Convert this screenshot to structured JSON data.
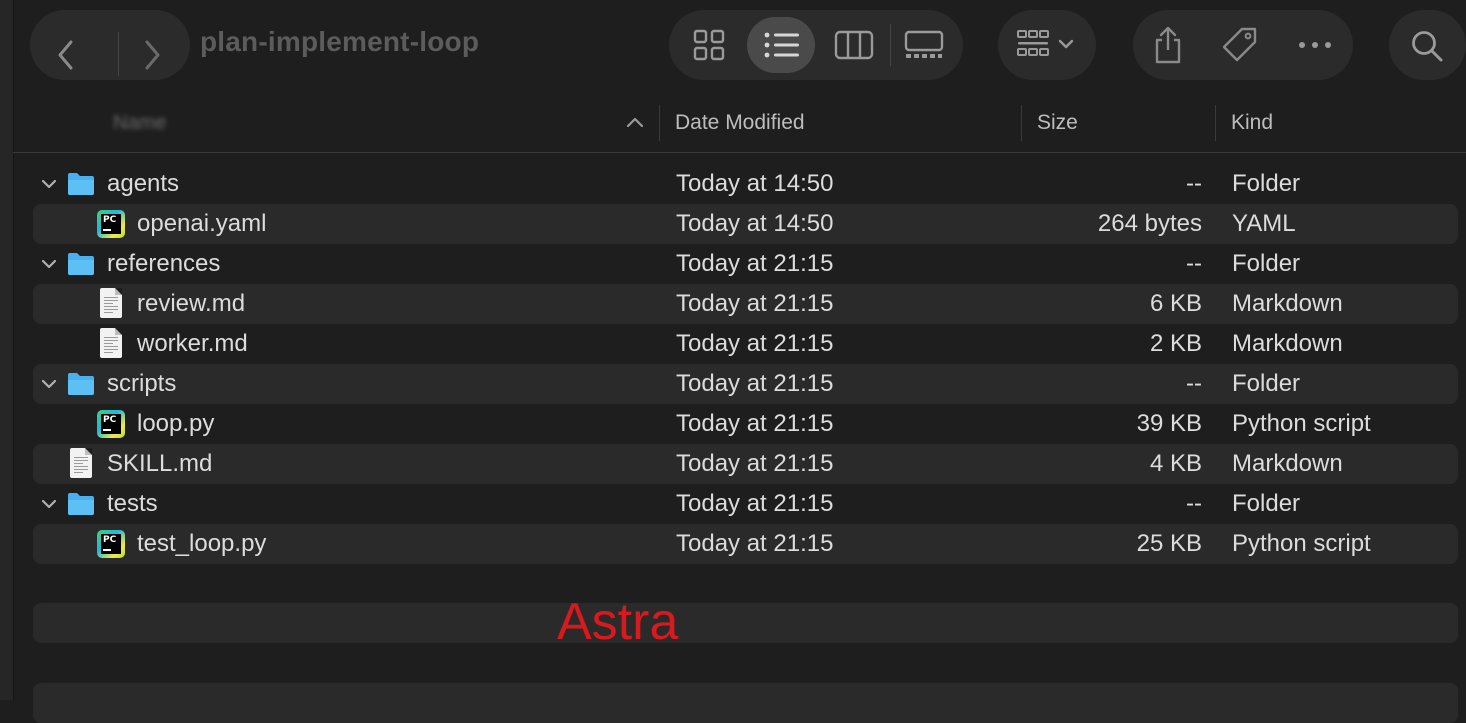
{
  "window": {
    "title": "plan-implement-loop"
  },
  "columns": {
    "name": "Name",
    "date": "Date Modified",
    "size": "Size",
    "kind": "Kind"
  },
  "icons": {
    "back": "chevron-left-icon",
    "forward": "chevron-right-icon",
    "view_icons": "grid-icon",
    "view_list": "list-icon",
    "view_columns": "columns-icon",
    "view_gallery": "gallery-icon",
    "group": "group-icon",
    "share": "share-icon",
    "tag": "tag-icon",
    "more": "ellipsis-icon",
    "search": "search-icon"
  },
  "rows": [
    {
      "name": "agents",
      "date": "Today at 14:50",
      "size": "--",
      "kind": "Folder",
      "type": "folder",
      "level": 0,
      "expanded": true
    },
    {
      "name": "openai.yaml",
      "date": "Today at 14:50",
      "size": "264 bytes",
      "kind": "YAML",
      "type": "pycharm",
      "level": 1
    },
    {
      "name": "references",
      "date": "Today at 21:15",
      "size": "--",
      "kind": "Folder",
      "type": "folder",
      "level": 0,
      "expanded": true
    },
    {
      "name": "review.md",
      "date": "Today at 21:15",
      "size": "6 KB",
      "kind": "Markdown",
      "type": "doc",
      "level": 1
    },
    {
      "name": "worker.md",
      "date": "Today at 21:15",
      "size": "2 KB",
      "kind": "Markdown",
      "type": "doc",
      "level": 1
    },
    {
      "name": "scripts",
      "date": "Today at 21:15",
      "size": "--",
      "kind": "Folder",
      "type": "folder",
      "level": 0,
      "expanded": true
    },
    {
      "name": "loop.py",
      "date": "Today at 21:15",
      "size": "39 KB",
      "kind": "Python script",
      "type": "pycharm",
      "level": 1
    },
    {
      "name": "SKILL.md",
      "date": "Today at 21:15",
      "size": "4 KB",
      "kind": "Markdown",
      "type": "doc",
      "level": 0
    },
    {
      "name": "tests",
      "date": "Today at 21:15",
      "size": "--",
      "kind": "Folder",
      "type": "folder",
      "level": 0,
      "expanded": true
    },
    {
      "name": "test_loop.py",
      "date": "Today at 21:15",
      "size": "25 KB",
      "kind": "Python script",
      "type": "pycharm",
      "level": 1
    }
  ],
  "watermark": "Astra",
  "colors": {
    "folder": "#4ab0ec",
    "watermark": "#d8191d",
    "selected_view": "#4a4a4a"
  }
}
